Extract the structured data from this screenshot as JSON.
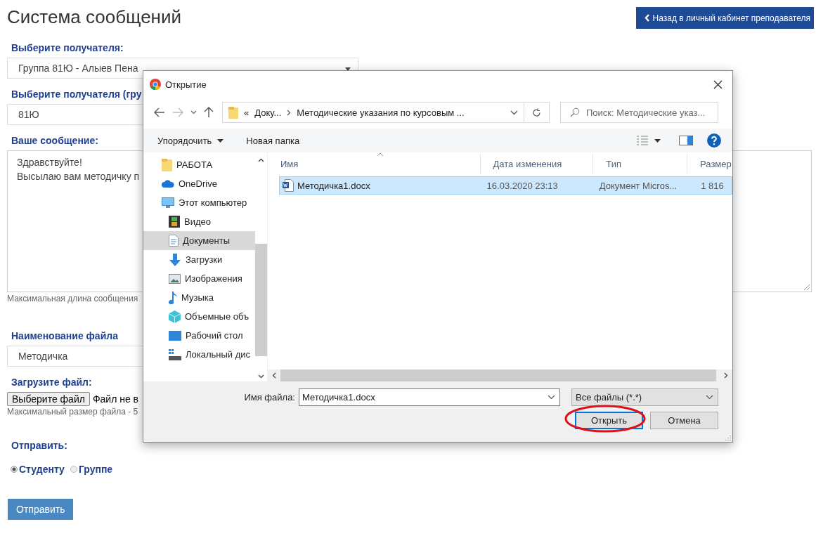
{
  "page": {
    "title": "Система сообщений",
    "back_button": "Назад в личный кабинет преподавателя",
    "recipient": {
      "label": "Выберите получателя:",
      "value": "Группа 81Ю - Алыев Пена"
    },
    "group": {
      "label": "Выберите получателя (гру",
      "value": "81Ю"
    },
    "message": {
      "label": "Ваше сообщение:",
      "lines": [
        "Здравствуйте!",
        "Высылаю вам методичку п"
      ],
      "hint": "Максимальная длина сообщения"
    },
    "file_name": {
      "label": "Наименование файла",
      "value": "Методичка"
    },
    "upload": {
      "label": "Загрузите файл:",
      "button": "Выберите файл",
      "status": "Файл не в",
      "hint": "Максимальный размер файла - 5"
    },
    "send_to": {
      "label": "Отправить:",
      "options": [
        {
          "label": "Студенту",
          "selected": true
        },
        {
          "label": "Группе",
          "selected": false
        }
      ]
    },
    "submit": "Отправить"
  },
  "dialog": {
    "title": "Открытие",
    "path": {
      "prefix": "«",
      "segments": [
        "Доку...",
        "Методические указания по курсовым ..."
      ]
    },
    "search": {
      "placeholder": "Поиск: Методические указ..."
    },
    "toolbar": [
      "Упорядочить",
      "Новая папка"
    ],
    "nav": [
      {
        "label": "РАБОТА",
        "kind": "folder",
        "selected": false
      },
      {
        "label": "OneDrive",
        "kind": "cloud",
        "selected": false
      },
      {
        "label": "Этот компьютер",
        "kind": "computer",
        "selected": false,
        "children": [
          {
            "label": "Видео",
            "kind": "video",
            "selected": false
          },
          {
            "label": "Документы",
            "kind": "documents",
            "selected": true
          },
          {
            "label": "Загрузки",
            "kind": "downloads",
            "selected": false
          },
          {
            "label": "Изображения",
            "kind": "pictures",
            "selected": false
          },
          {
            "label": "Музыка",
            "kind": "music",
            "selected": false
          },
          {
            "label": "Объемные объ",
            "kind": "objects",
            "selected": false
          },
          {
            "label": "Рабочий стол",
            "kind": "desktop",
            "selected": false
          },
          {
            "label": "Локальный дис",
            "kind": "disk",
            "selected": false
          }
        ]
      }
    ],
    "columns": [
      "Имя",
      "Дата изменения",
      "Тип",
      "Размер"
    ],
    "files": [
      {
        "name": "Методичка1.docx",
        "date": "16.03.2020 23:13",
        "type": "Документ Micros...",
        "size": "1 816",
        "selected": true
      }
    ],
    "file_name_label": "Имя файла:",
    "file_name_value": "Методичка1.docx",
    "filter": "Все файлы (*.*)",
    "open_button": "Открыть",
    "cancel_button": "Отмена"
  }
}
